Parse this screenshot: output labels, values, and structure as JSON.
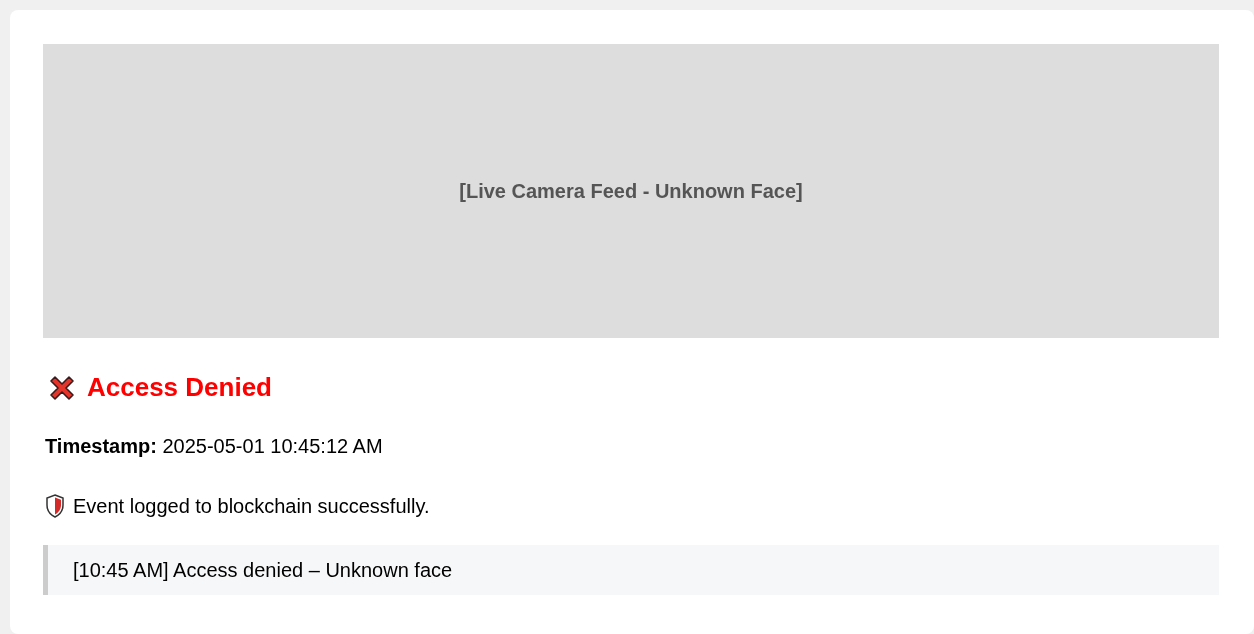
{
  "camera_feed": {
    "label": "[Live Camera Feed - Unknown Face]"
  },
  "status": {
    "kind": "denied",
    "title": "Access Denied"
  },
  "timestamp": {
    "label": "Timestamp:",
    "value": "2025-05-01 10:45:12 AM"
  },
  "notice": {
    "kind": "shield",
    "text": "Event logged to blockchain successfully."
  },
  "log": [
    "[10:45 AM] Access denied – Unknown face"
  ]
}
